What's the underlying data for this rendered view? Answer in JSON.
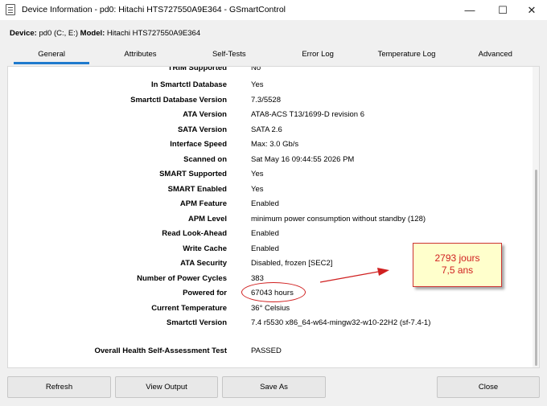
{
  "window": {
    "title": "Device Information - pd0: Hitachi HTS727550A9E364 - GSmartControl",
    "minimize": "—",
    "maximize": "☐",
    "close": "✕"
  },
  "device_line": {
    "device_label": "Device:",
    "device_value": "pd0 (C:, E:)",
    "model_label": "Model:",
    "model_value": "Hitachi HTS727550A9E364"
  },
  "tabs": [
    "General",
    "Attributes",
    "Self-Tests",
    "Error Log",
    "Temperature Log",
    "Advanced"
  ],
  "info_rows": [
    {
      "label": "TRIM Supported",
      "value": "No"
    },
    {
      "label": "In Smartctl Database",
      "value": "Yes"
    },
    {
      "label": "Smartctl Database Version",
      "value": "7.3/5528"
    },
    {
      "label": "ATA Version",
      "value": "ATA8-ACS T13/1699-D revision 6"
    },
    {
      "label": "SATA Version",
      "value": "SATA 2.6"
    },
    {
      "label": "Interface Speed",
      "value": "Max: 3.0 Gb/s"
    },
    {
      "label": "Scanned on",
      "value": "Sat May 16 09:44:55 2026 PM"
    },
    {
      "label": "SMART Supported",
      "value": "Yes"
    },
    {
      "label": "SMART Enabled",
      "value": "Yes"
    },
    {
      "label": "APM Feature",
      "value": "Enabled"
    },
    {
      "label": "APM Level",
      "value": "minimum power consumption without standby (128)"
    },
    {
      "label": "Read Look-Ahead",
      "value": "Enabled"
    },
    {
      "label": "Write Cache",
      "value": "Enabled"
    },
    {
      "label": "ATA Security",
      "value": "Disabled, frozen [SEC2]"
    },
    {
      "label": "Number of Power Cycles",
      "value": "383"
    },
    {
      "label": "Powered for",
      "value": "67043 hours"
    },
    {
      "label": "Current Temperature",
      "value": "36° Celsius"
    },
    {
      "label": "Smartctl Version",
      "value": "7.4 r5530 x86_64-w64-mingw32-w10-22H2 (sf-7.4-1)"
    }
  ],
  "health": {
    "label": "Overall Health Self-Assessment Test",
    "value": "PASSED"
  },
  "buttons": {
    "refresh": "Refresh",
    "view_output": "View Output",
    "save_as": "Save As",
    "close": "Close"
  },
  "annotation": {
    "line1": "2793 jours",
    "line2": "7,5 ans",
    "color": "#d02020"
  }
}
